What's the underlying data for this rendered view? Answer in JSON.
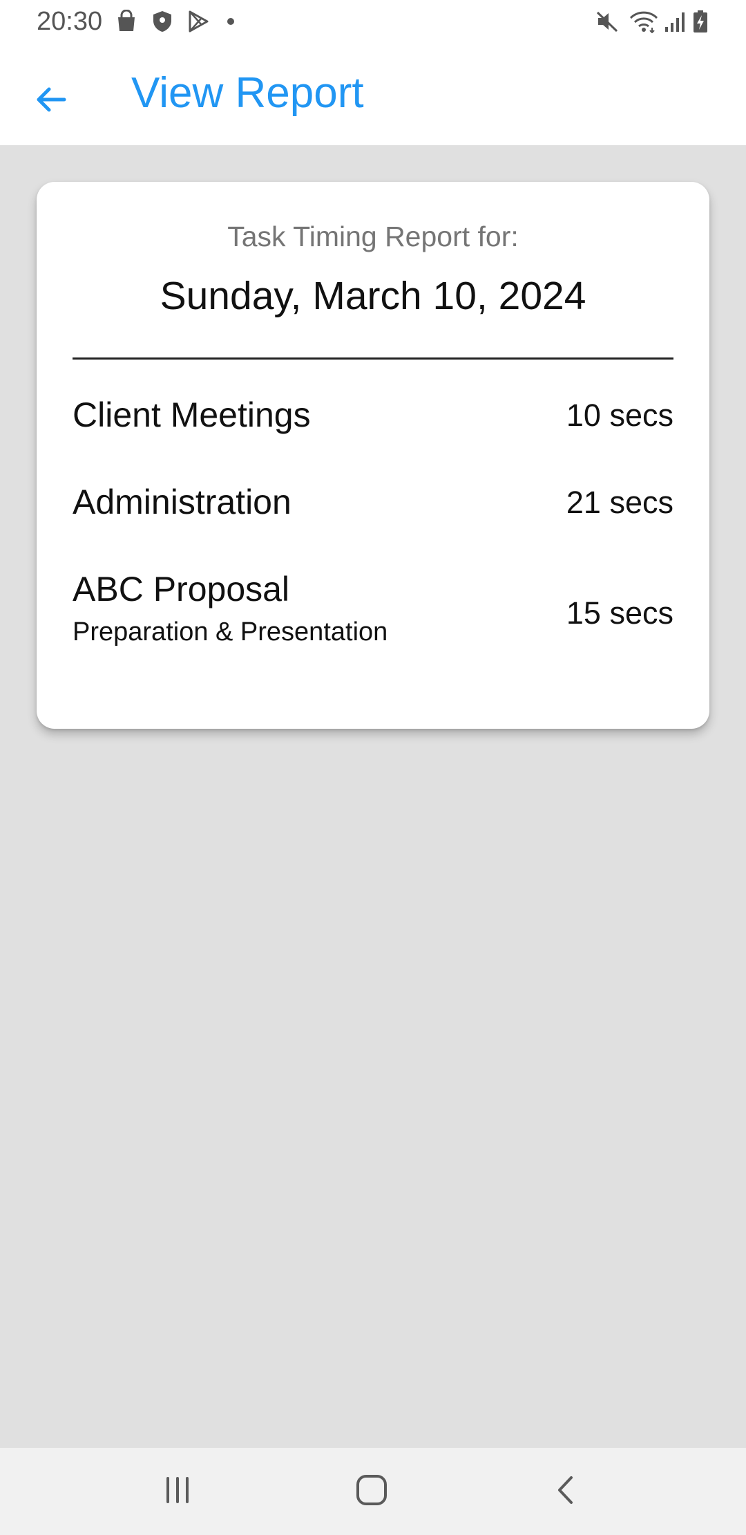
{
  "status_bar": {
    "time": "20:30",
    "left_icons": [
      "shopping-bag-icon",
      "shield-icon",
      "play-store-icon",
      "dot-icon"
    ],
    "right_icons": [
      "mute-icon",
      "wifi-icon",
      "signal-icon",
      "battery-charging-icon"
    ]
  },
  "app_bar": {
    "title": "View Report",
    "back_icon": "arrow-left-icon",
    "accent_color": "#2196f3"
  },
  "report": {
    "heading": "Task Timing Report for:",
    "date": "Sunday, March 10, 2024",
    "tasks": [
      {
        "name": "Client Meetings",
        "subtitle": "",
        "duration": "10 secs"
      },
      {
        "name": "Administration",
        "subtitle": "",
        "duration": "21 secs"
      },
      {
        "name": "ABC Proposal",
        "subtitle": "Preparation & Presentation",
        "duration": "15 secs"
      }
    ]
  },
  "nav_bar": {
    "icons": [
      "recent-apps-icon",
      "home-icon",
      "back-nav-icon"
    ]
  },
  "colors": {
    "background": "#e0e0e0",
    "card": "#ffffff",
    "nav_bar": "#f1f1f1"
  }
}
